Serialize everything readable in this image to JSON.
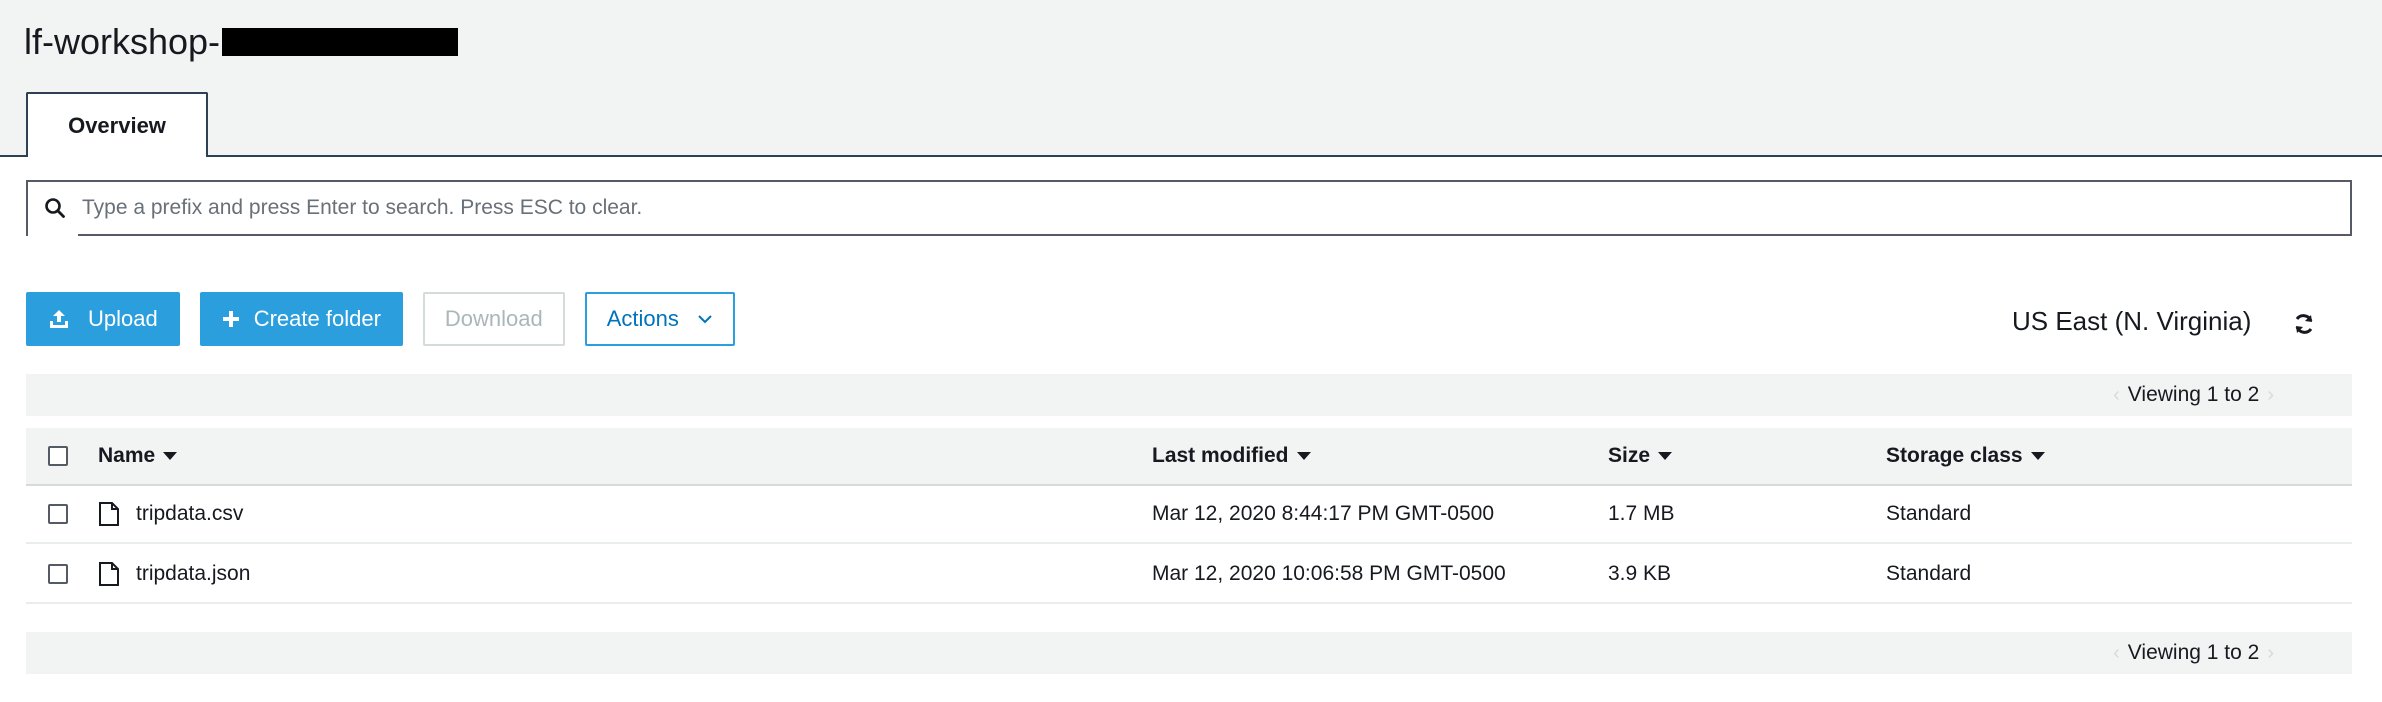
{
  "header": {
    "bucket_title": "lf-workshop-",
    "tab_overview": "Overview"
  },
  "search": {
    "placeholder": "Type a prefix and press Enter to search. Press ESC to clear."
  },
  "toolbar": {
    "upload": "Upload",
    "create_folder": "Create folder",
    "download": "Download",
    "actions": "Actions"
  },
  "region": "US East (N. Virginia)",
  "pager": {
    "top": "Viewing 1 to 2",
    "bottom": "Viewing 1 to 2"
  },
  "table": {
    "headers": {
      "name": "Name",
      "last_modified": "Last modified",
      "size": "Size",
      "storage_class": "Storage class"
    },
    "rows": [
      {
        "name": "tripdata.csv",
        "last_modified": "Mar 12, 2020 8:44:17 PM GMT-0500",
        "size": "1.7 MB",
        "storage_class": "Standard"
      },
      {
        "name": "tripdata.json",
        "last_modified": "Mar 12, 2020 10:06:58 PM GMT-0500",
        "size": "3.9 KB",
        "storage_class": "Standard"
      }
    ]
  },
  "colors": {
    "primary": "#2b9fde",
    "link": "#0073bb",
    "header_bg": "#f2f3f3",
    "tab_border": "#2e4154",
    "disabled_text": "#aab7b8"
  },
  "icons": {
    "search": "search-icon",
    "upload": "upload-icon",
    "create_folder": "plus-icon",
    "actions": "chevron-down-icon",
    "refresh": "refresh-icon",
    "file": "file-icon",
    "sort": "caret-down-icon"
  }
}
